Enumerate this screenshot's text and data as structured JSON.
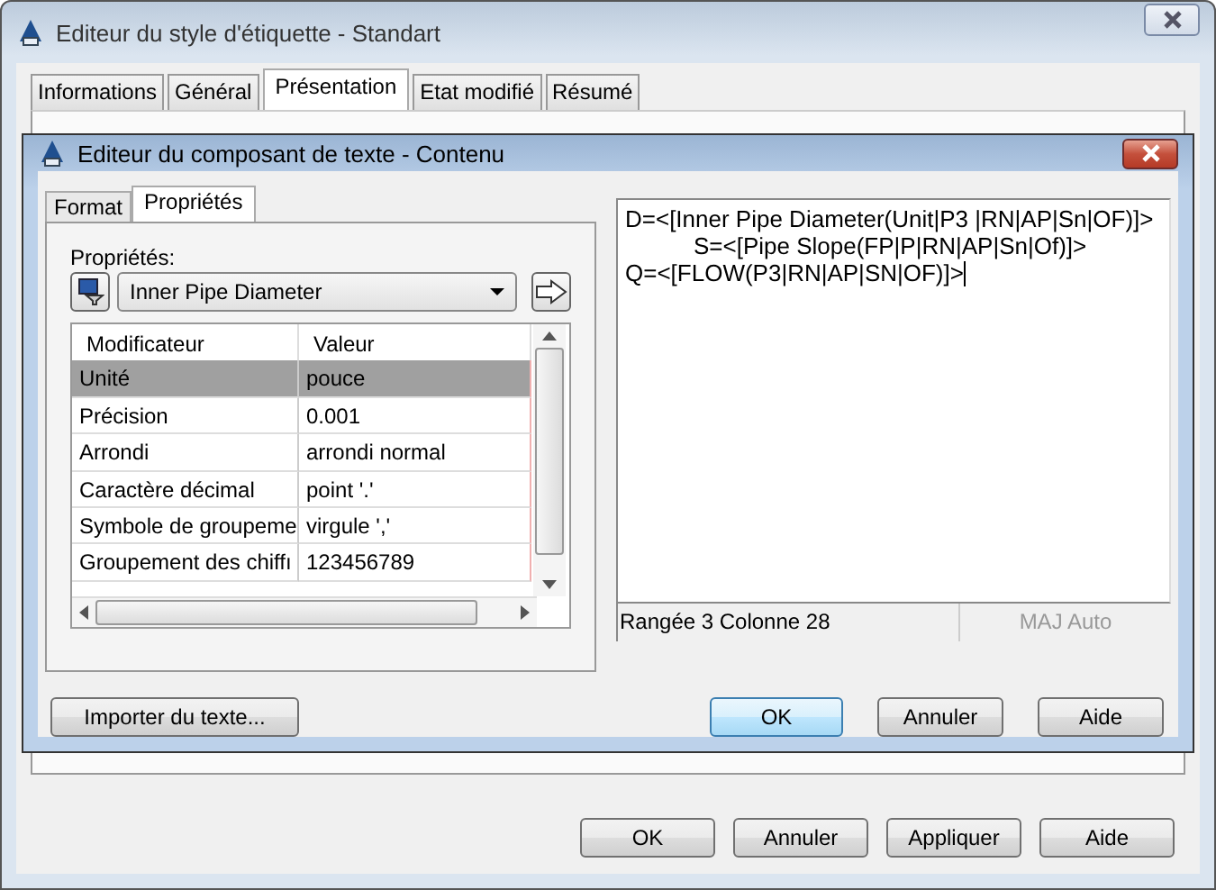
{
  "window": {
    "title": "Editeur du style d'étiquette - Standart"
  },
  "tabs": [
    {
      "label": "Informations",
      "selected": false
    },
    {
      "label": "Général",
      "selected": false
    },
    {
      "label": "Présentation",
      "selected": true
    },
    {
      "label": "Etat modifié",
      "selected": false
    },
    {
      "label": "Résumé",
      "selected": false
    }
  ],
  "buttons": [
    "OK",
    "Annuler",
    "Appliquer",
    "Aide"
  ],
  "dialog": {
    "title": "Editeur du composant de texte - Contenu",
    "tabs": [
      {
        "label": "Format",
        "selected": false
      },
      {
        "label": "Propriétés",
        "selected": true
      }
    ],
    "properties_label": "Propriétés:",
    "property": "Inner Pipe Diameter",
    "grid": {
      "columns": [
        "Modificateur",
        "Valeur"
      ],
      "rows": [
        {
          "cells": [
            "Unité",
            "pouce"
          ],
          "selected": true
        },
        {
          "cells": [
            "Précision",
            "0.001"
          ],
          "selected": false
        },
        {
          "cells": [
            "Arrondi",
            "arrondi normal"
          ],
          "selected": false
        },
        {
          "cells": [
            "Caractère décimal",
            "point '.'"
          ],
          "selected": false
        },
        {
          "cells": [
            "Symbole de groupeme",
            "virgule ','"
          ],
          "selected": false
        },
        {
          "cells": [
            "Groupement des chiffı",
            "123456789"
          ],
          "selected": false
        }
      ]
    },
    "editor": {
      "lines": [
        {
          "text": "D=<[Inner Pipe Diameter(Unit|P3  |RN|AP|Sn|OF)]>",
          "indent": false,
          "caret": false
        },
        {
          "text": "S=<[Pipe Slope(FP|P|RN|AP|Sn|Of)]>",
          "indent": true,
          "caret": false
        },
        {
          "text": "Q=<[FLOW(P3|RN|AP|SN|OF)]>",
          "indent": false,
          "caret": true
        }
      ],
      "position": "Rangée 3 Colonne 28",
      "caps": {
        "label": "MAJ Auto",
        "disabled": true
      }
    },
    "import_button": "Importer du texte...",
    "buttons": [
      {
        "label": "OK",
        "default": true
      },
      {
        "label": "Annuler",
        "default": false
      },
      {
        "label": "Aide",
        "default": false
      }
    ]
  }
}
